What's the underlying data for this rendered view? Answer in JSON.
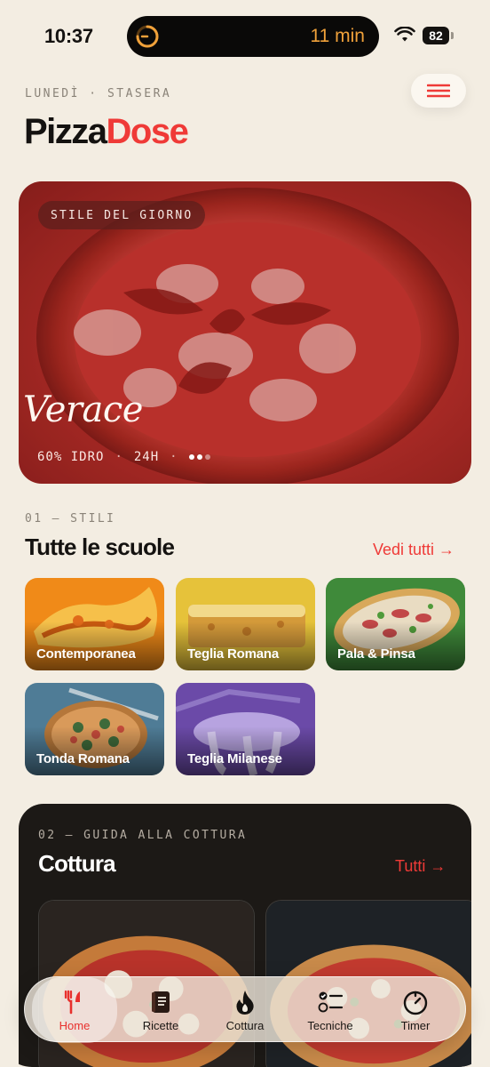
{
  "status": {
    "time": "10:37",
    "timer": "11 min",
    "battery": "82"
  },
  "header": {
    "eyebrow": "LUNEDÌ · STASERA",
    "brand_part1": "Pizza",
    "brand_part2": "Dose"
  },
  "hero": {
    "chip": "STILE DEL GIORNO",
    "title": "Verace",
    "meta_hydration": "60% IDRO",
    "meta_sep": "·",
    "meta_time": "24H"
  },
  "styles_section": {
    "eyebrow": "01 — STILI",
    "title": "Tutte le scuole",
    "see_all": "Vedi tutti →",
    "tiles": [
      {
        "label": "Contemporanea"
      },
      {
        "label": "Teglia Romana"
      },
      {
        "label": "Pala & Pinsa"
      },
      {
        "label": "Tonda Romana"
      },
      {
        "label": "Teglia Milanese"
      }
    ]
  },
  "cooking_section": {
    "eyebrow": "02 — GUIDA ALLA COTTURA",
    "title": "Cottura",
    "see_all": "Tutti →"
  },
  "tabbar": {
    "tabs": [
      {
        "label": "Home",
        "icon": "fork-knife-icon",
        "active": true
      },
      {
        "label": "Ricette",
        "icon": "book-icon"
      },
      {
        "label": "Cottura",
        "icon": "flame-icon"
      },
      {
        "label": "Tecniche",
        "icon": "checklist-icon"
      },
      {
        "label": "Timer",
        "icon": "timer-icon"
      }
    ]
  },
  "colors": {
    "accent": "#ef3a37",
    "background": "#f3ede2",
    "dark_card": "#1c1916"
  }
}
